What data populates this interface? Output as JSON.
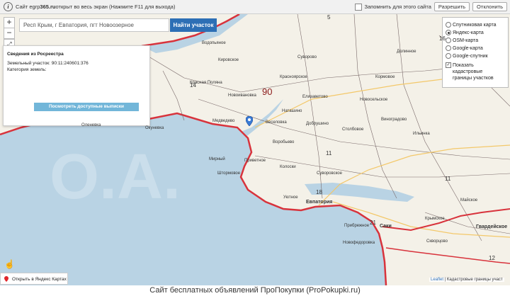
{
  "notice": {
    "prefix": "Сайт egrp",
    "domain_bold": "365.ru",
    "suffix": " открыт во весь экран (Нажмите F11 для выхода)",
    "remember_label": "Запомнить для этого сайта",
    "allow_label": "Разрешить",
    "deny_label": "Отклонить"
  },
  "zoom": {
    "in": "+",
    "out": "−",
    "fullscreen": "⤢"
  },
  "search": {
    "value": "Респ Крым, г Евпатория, пгт Новоозерное",
    "button": "Найти участок"
  },
  "popup": {
    "title": "Сведения из Росреестра",
    "parcel_label": "Земельный участок:",
    "parcel_value": "90:11:240601:376",
    "category_label": "Категория земель:",
    "button": "Посмотреть доступные выписки"
  },
  "layers": {
    "options": [
      {
        "label": "Спутниковая карта",
        "selected": false
      },
      {
        "label": "Яндекс-карта",
        "selected": true
      },
      {
        "label": "OSM-карта",
        "selected": false
      },
      {
        "label": "Google-карта",
        "selected": false
      },
      {
        "label": "Google-спутник",
        "selected": false
      }
    ],
    "cadastre_line1": "Показать",
    "cadastre_line2": "кадастровые",
    "cadastre_line3": "границы участков",
    "cadastre_checked": "✓"
  },
  "open_yandex": "Открыть в Яндекс Картах",
  "attribution": {
    "leaflet": "Leaflet",
    "rest": " | Кадастровые границы участ"
  },
  "map_labels": {
    "vodopyanoye": "Водопьяное",
    "kirovskoye": "Кировское",
    "krasnaya_polyana": "Красная Поляна",
    "novoivanovka": "Новоивановка",
    "krasnoyarskoye": "Красноярское",
    "kormovoye": "Кормовое",
    "elizavetovo": "Елизаветово",
    "natashino": "Наташино",
    "novoselskoye": "Новосельское",
    "veselovka": "Веселовка",
    "dobrushino": "Добрушино",
    "vinogradovo": "Виноградово",
    "stolbovoye": "Столбовое",
    "ilyinka": "Ильинка",
    "okunevka": "Окуневка",
    "medvedevo": "Медведево",
    "vorobyovo": "Воробьево",
    "mirny": "Мирный",
    "shtormovoye": "Штормовое",
    "privetnoye": "Приветное",
    "kolosky": "Колоски",
    "suvorovskoye": "Суворовское",
    "uyutnoye": "Уютное",
    "yevpatoria": "Евпатория",
    "krymskoye": "Крымское",
    "sakhy": "Саки",
    "gvardeyskoye": "Гвардейское",
    "mayskoye": "Майское",
    "skvortsovo": "Скворцово",
    "chernomorskoye": "Оленевка",
    "suvorovo": "Суворово",
    "prirubnoye": "Прибрежное",
    "novofedorovka": "Новофедоровка",
    "dolinnoye": "Долинное",
    "n5": "5",
    "n90": "90",
    "n11a": "11",
    "n11b": "11",
    "n14": "14",
    "n18": "18",
    "n21": "21",
    "n12": "12",
    "n16": "16"
  },
  "footer": "Сайт бесплатных объявлений ПроПокупки (ProPokupki.ru)"
}
